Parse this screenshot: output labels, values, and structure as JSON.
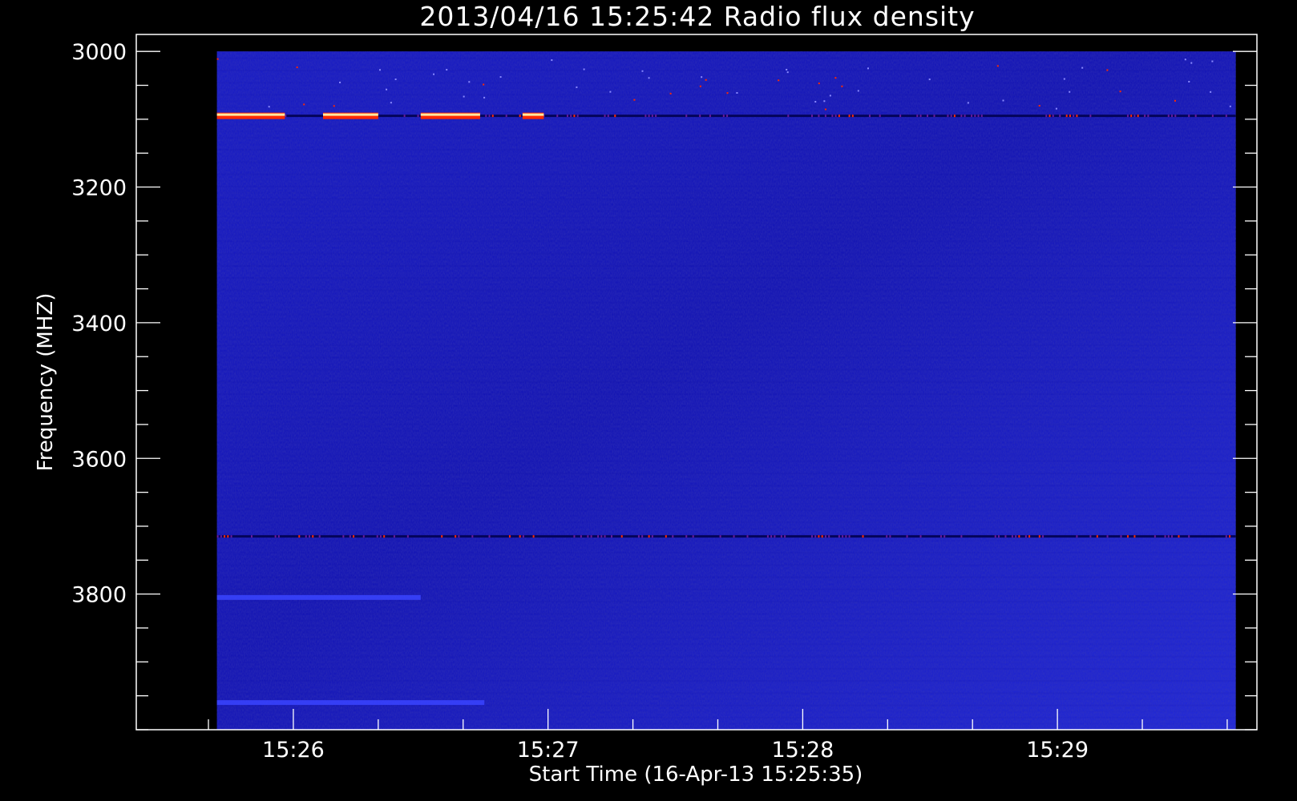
{
  "chart_data": {
    "type": "heatmap",
    "title": "2013/04/16 15:25:42 Radio flux density",
    "xlabel": "Start Time (16-Apr-13 15:25:35)",
    "ylabel": "Frequency (MHZ)",
    "x_range_seconds": [
      -12,
      252
    ],
    "y_range": [
      2975,
      4000
    ],
    "data_x_range_seconds": [
      7,
      247
    ],
    "data_y_range": [
      3000,
      4000
    ],
    "x_major_ticks": [
      {
        "label": "15:26",
        "t": 25
      },
      {
        "label": "15:27",
        "t": 85
      },
      {
        "label": "15:28",
        "t": 145
      },
      {
        "label": "15:29",
        "t": 205
      }
    ],
    "x_minor_step_seconds": 20,
    "y_major_ticks": [
      3000,
      3200,
      3400,
      3600,
      3800
    ],
    "y_minor_step": 50,
    "colors": {
      "background": "#000000",
      "axes": "#ffffff",
      "base": "#1a1ad2",
      "base_dark": "#0d0daa",
      "hot": "#ff2a00",
      "warm": "#ffe9a0"
    },
    "features": [
      {
        "kind": "interference_line",
        "freq": 3095,
        "t_start": 7,
        "t_end": 247
      },
      {
        "kind": "burst_segment",
        "freq": 3095,
        "t_start": 7,
        "t_end": 23
      },
      {
        "kind": "burst_segment",
        "freq": 3095,
        "t_start": 32,
        "t_end": 45
      },
      {
        "kind": "burst_segment",
        "freq": 3095,
        "t_start": 55,
        "t_end": 69
      },
      {
        "kind": "burst_segment",
        "freq": 3095,
        "t_start": 79,
        "t_end": 84
      },
      {
        "kind": "interference_line",
        "freq": 3715,
        "t_start": 7,
        "t_end": 247
      },
      {
        "kind": "bright_band",
        "freq": 3805,
        "t_start": 7,
        "t_end": 55
      },
      {
        "kind": "bright_band",
        "freq": 3960,
        "t_start": 7,
        "t_end": 70
      }
    ]
  }
}
